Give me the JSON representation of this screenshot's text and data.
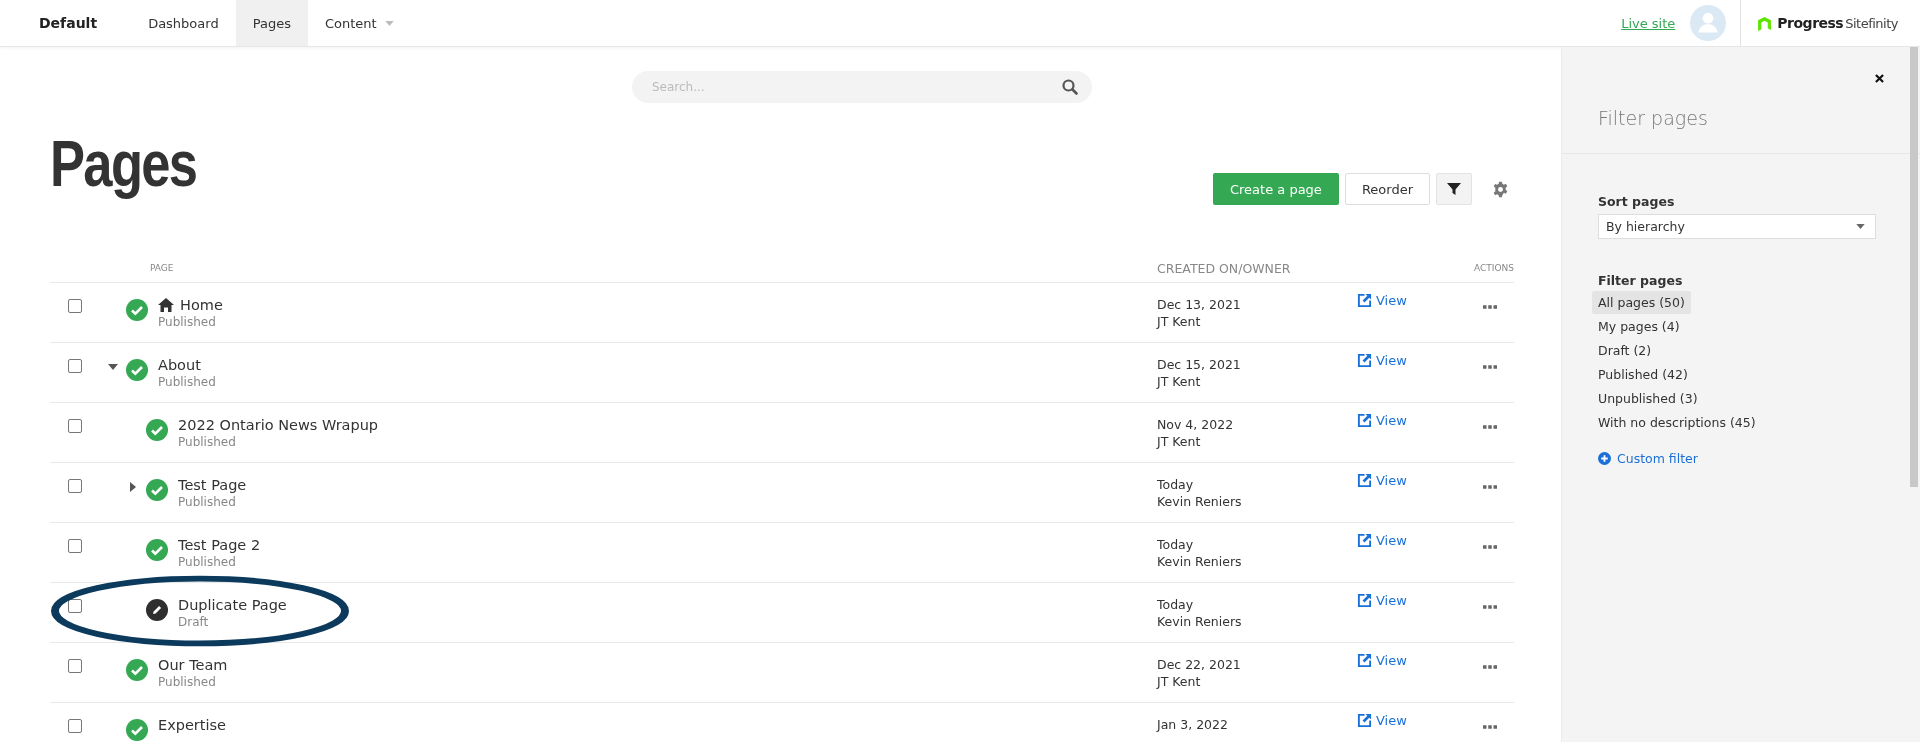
{
  "topbar": {
    "site": "Default",
    "tabs": [
      {
        "label": "Dashboard",
        "selected": false,
        "dropdown": false
      },
      {
        "label": "Pages",
        "selected": true,
        "dropdown": false
      },
      {
        "label": "Content",
        "selected": false,
        "dropdown": true
      }
    ],
    "live_site": "Live site",
    "logo": {
      "brand": "Progress",
      "product": "Sitefinity"
    }
  },
  "search": {
    "placeholder": "Search..."
  },
  "title": "Pages",
  "toolbar": {
    "create": "Create a page",
    "reorder": "Reorder"
  },
  "table": {
    "columns": [
      "PAGE",
      "CREATED ON/OWNER",
      "ACTIONS"
    ],
    "rows": [
      {
        "title": "Home",
        "home": true,
        "kind": "published",
        "status": "Published",
        "created": "Dec 13, 2021",
        "owner": "JT Kent",
        "view": "View",
        "checked": false,
        "has_children": false,
        "highlighted": false
      },
      {
        "title": "About",
        "home": false,
        "kind": "published",
        "status": "Published",
        "created": "Dec 15, 2021",
        "owner": "JT Kent",
        "view": "View",
        "checked": false,
        "has_children": true,
        "expanded": true,
        "highlighted": false,
        "children": [
          {
            "title": "2022 Ontario News Wrapup",
            "home": false,
            "kind": "published",
            "status": "Published",
            "created": "Nov 4, 2022",
            "owner": "JT Kent",
            "view": "View",
            "checked": false,
            "has_children": false,
            "highlighted": false
          },
          {
            "title": "Test Page",
            "home": false,
            "kind": "published",
            "status": "Published",
            "created": "Today",
            "owner": "Kevin Reniers",
            "view": "View",
            "checked": false,
            "has_children": true,
            "expanded": false,
            "highlighted": false
          },
          {
            "title": "Test Page 2",
            "home": false,
            "kind": "published",
            "status": "Published",
            "created": "Today",
            "owner": "Kevin Reniers",
            "view": "View",
            "checked": false,
            "has_children": false,
            "highlighted": false
          },
          {
            "title": "Duplicate Page",
            "home": false,
            "kind": "draft",
            "status": "Draft",
            "created": "Today",
            "owner": "Kevin Reniers",
            "view": "View",
            "checked": false,
            "has_children": false,
            "highlighted": true
          }
        ]
      },
      {
        "title": "Our Team",
        "home": false,
        "kind": "published",
        "status": "Published",
        "created": "Dec 22, 2021",
        "owner": "JT Kent",
        "view": "View",
        "checked": false,
        "has_children": false,
        "highlighted": false
      },
      {
        "title": "Expertise",
        "home": false,
        "kind": "published",
        "created": "Jan 3, 2022",
        "view": "View",
        "checked": false,
        "has_children": false,
        "highlighted": false
      }
    ]
  },
  "filter_panel": {
    "title": "Filter pages",
    "sort_label": "Sort pages",
    "sort_value": "By hierarchy",
    "filter_label": "Filter pages",
    "filters": [
      {
        "label": "All pages (50)",
        "selected": true
      },
      {
        "label": "My pages (4)",
        "selected": false
      },
      {
        "label": "Draft (2)",
        "selected": false
      },
      {
        "label": "Published (42)",
        "selected": false
      },
      {
        "label": "Unpublished (3)",
        "selected": false
      },
      {
        "label": "With no descriptions (45)",
        "selected": false
      }
    ],
    "custom_filter": "Custom filter"
  }
}
